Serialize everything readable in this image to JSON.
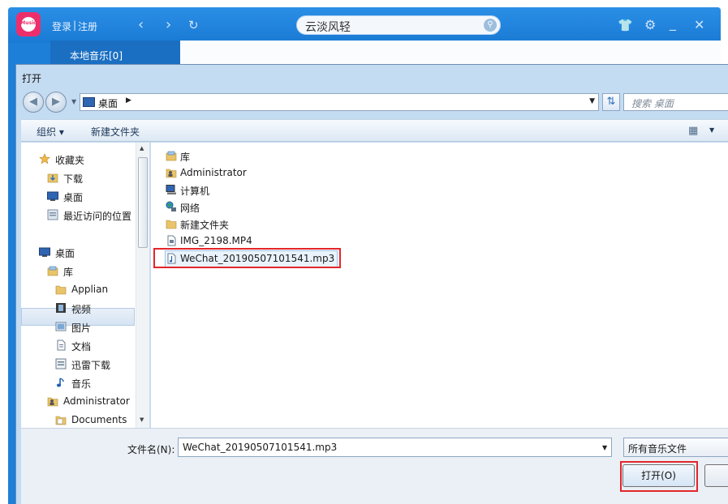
{
  "player": {
    "logo_text": "Music",
    "login": "登录",
    "separator": "|",
    "register": "注册",
    "search_value": "云淡风轻",
    "local_music_tab": "本地音乐[0]"
  },
  "dialog": {
    "title": "打开",
    "address": {
      "location": "桌面"
    },
    "search_placeholder": "搜索 桌面",
    "toolbar": {
      "organize": "组织 ▾",
      "new_folder": "新建文件夹"
    },
    "nav_tree": [
      {
        "label": "收藏夹",
        "icon": "star-icon"
      },
      {
        "label": "下载",
        "icon": "download-folder-icon"
      },
      {
        "label": "桌面",
        "icon": "desktop-icon"
      },
      {
        "label": "最近访问的位置",
        "icon": "recent-places-icon"
      },
      {
        "label": "桌面",
        "icon": "desktop-icon"
      },
      {
        "label": "库",
        "icon": "library-icon"
      },
      {
        "label": "Applian",
        "icon": "folder-icon"
      },
      {
        "label": "视频",
        "icon": "video-library-icon"
      },
      {
        "label": "图片",
        "icon": "pictures-library-icon"
      },
      {
        "label": "文档",
        "icon": "documents-library-icon"
      },
      {
        "label": "迅雷下载",
        "icon": "thunder-download-icon"
      },
      {
        "label": "音乐",
        "icon": "music-library-icon"
      },
      {
        "label": "Administrator",
        "icon": "user-folder-icon"
      },
      {
        "label": "Documents",
        "icon": "folder-icon"
      }
    ],
    "files": [
      {
        "label": "库",
        "icon": "library-icon"
      },
      {
        "label": "Administrator",
        "icon": "user-folder-icon"
      },
      {
        "label": "计算机",
        "icon": "computer-icon"
      },
      {
        "label": "网络",
        "icon": "network-icon"
      },
      {
        "label": "新建文件夹",
        "icon": "folder-icon"
      },
      {
        "label": "IMG_2198.MP4",
        "icon": "video-file-icon"
      },
      {
        "label": "WeChat_20190507101541.mp3",
        "icon": "audio-file-icon"
      }
    ],
    "filename_label": "文件名(N):",
    "filename_value": "WeChat_20190507101541.mp3",
    "filetype_value": "所有音乐文件",
    "open_button": "打开(O)"
  },
  "colors": {
    "player_blue": "#1e7fd8",
    "dialog_frame": "#c4dcf2",
    "highlight_red": "#e2262b",
    "logo_pink": "#ec2f6c"
  }
}
